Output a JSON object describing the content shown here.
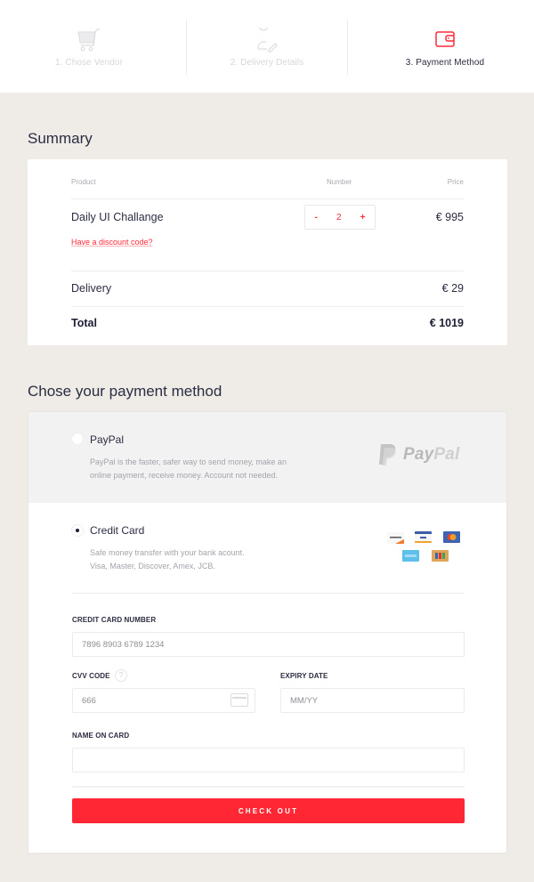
{
  "steps": [
    {
      "label": "1. Chose Vendor",
      "icon": "cart-icon",
      "active": false
    },
    {
      "label": "2. Delivery Details",
      "icon": "user-edit-icon",
      "active": false
    },
    {
      "label": "3. Payment Method",
      "icon": "wallet-icon",
      "active": true
    }
  ],
  "summary": {
    "title": "Summary",
    "headers": {
      "product": "Product",
      "number": "Number",
      "price": "Price"
    },
    "item": {
      "name": "Daily UI Challange",
      "quantity": "2",
      "minus": "-",
      "plus": "+",
      "price": "€ 995"
    },
    "discount_link": "Have a discount code?",
    "delivery": {
      "label": "Delivery",
      "price": "€ 29"
    },
    "total": {
      "label": "Total",
      "price": "€ 1019"
    }
  },
  "payment": {
    "title": "Chose your payment method",
    "paypal": {
      "label": "PayPal",
      "description_line1": "PayPal is the faster, safer way to send money, make an",
      "description_line2": "online payment, receive money. Account not needed.",
      "logo_pay": "Pay",
      "logo_pal": "Pal",
      "selected": false
    },
    "credit_card": {
      "label": "Credit Card",
      "description_line1": "Safe money transfer with your bank acount.",
      "description_line2": "Visa, Master, Discover, Amex, JCB.",
      "selected": true,
      "logos": [
        "Discover",
        "Visa",
        "MasterCard",
        "Amex",
        "JCB"
      ]
    },
    "form": {
      "card_number_label": "CREDIT CARD NUMBER",
      "card_number_placeholder": "7896 8903 6789 1234",
      "cvv_label": "CVV CODE",
      "cvv_help": "?",
      "cvv_placeholder": "666",
      "expiry_label": "EXPIRY DATE",
      "expiry_placeholder": "MM/YY",
      "name_label": "NAME ON CARD",
      "name_placeholder": ""
    },
    "checkout_label": "CHECK OUT"
  },
  "colors": {
    "accent": "#ff2734",
    "background": "#efebe7",
    "text": "#2b2d42"
  }
}
